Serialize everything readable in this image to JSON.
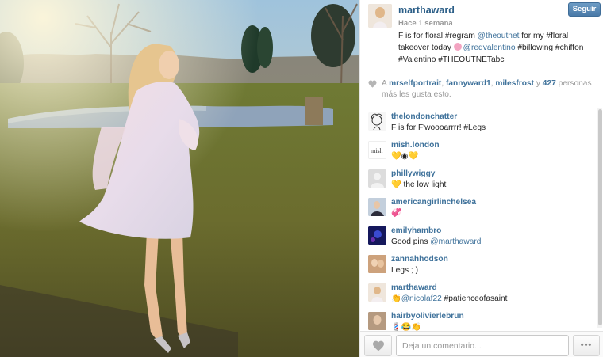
{
  "post": {
    "username": "marthaward",
    "time": "Hace 1 semana",
    "follow_label": "Seguir",
    "caption": {
      "part1": "F is for floral #regram ",
      "mention1": "@theoutnet",
      "part2": " for my #floral takeover today ",
      "mention2": "@redvalentino",
      "part3": " #billowing #chiffon #Valentino #THEOUTNETabc"
    }
  },
  "likes": {
    "prefix": "A",
    "user1": "mrselfportrait",
    "sep1": ",",
    "user2": "fannyward1",
    "sep2": ",",
    "user3": "milesfrost",
    "conj": "y",
    "count": "427",
    "suffix": "personas más les gusta esto."
  },
  "comments": [
    {
      "user": "thelondonchatter",
      "text": "F is for F'woooarrrr! #Legs",
      "avatar_color": "#f4f4f4",
      "avatar_icon": "sketch-face-icon"
    },
    {
      "user": "mish.london",
      "text": "💛◉💛",
      "avatar_color": "#ffffff",
      "avatar_icon": "mish-logo-icon"
    },
    {
      "user": "phillywiggy",
      "text": "💛 the low light",
      "avatar_color": "#dcdcdc",
      "avatar_icon": "default-avatar-icon"
    },
    {
      "user": "americangirlinchelsea",
      "text": "💞",
      "avatar_color": "#b9c6d6",
      "avatar_icon": "photo-avatar-icon"
    },
    {
      "user": "emilyhambro",
      "text": "Good pins ",
      "mention": "@marthaward",
      "avatar_color": "#1c1f6e",
      "avatar_icon": "photo-avatar-icon"
    },
    {
      "user": "zannahhodson",
      "text": "Legs ; )",
      "avatar_color": "#c49c7a",
      "avatar_icon": "photo-avatar-icon"
    },
    {
      "user": "marthaward",
      "text": " #patienceofasaint",
      "prefix_emoji": "👏",
      "mention": "@nicolaf22",
      "avatar_color": "#e9e0d6",
      "avatar_icon": "photo-avatar-icon"
    },
    {
      "user": "hairbyolivierlebrun",
      "text": "💈😂👏",
      "avatar_color": "#a88f78",
      "avatar_icon": "photo-avatar-icon"
    }
  ],
  "footer": {
    "comment_placeholder": "Deja un comentario...",
    "more_label": "•••"
  },
  "icons": {
    "like": "heart-icon",
    "more": "more-dots-icon"
  },
  "colors": {
    "link": "#3f729b",
    "follow_button": "#5485b3",
    "muted": "#999999"
  }
}
